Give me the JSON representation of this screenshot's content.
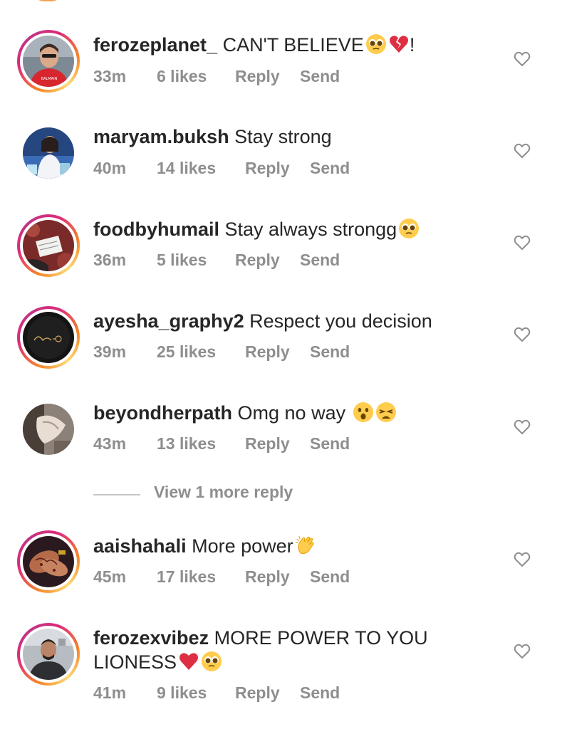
{
  "comments": [
    {
      "username": "ferozeplanet_",
      "text": "CAN'T BELIEVE",
      "text2": "",
      "emojis": [
        "pleading-face",
        "broken-heart"
      ],
      "suffix": "!",
      "time": "33m",
      "likes": "6 likes",
      "reply": "Reply",
      "send": "Send"
    },
    {
      "username": "maryam.buksh",
      "text": "Stay strong",
      "text2": "",
      "emojis": [],
      "suffix": "",
      "time": "40m",
      "likes": "14 likes",
      "reply": "Reply",
      "send": "Send"
    },
    {
      "username": "foodbyhumail",
      "text": "Stay always strongg",
      "text2": "",
      "emojis": [
        "pleading-face"
      ],
      "suffix": "",
      "time": "36m",
      "likes": "5 likes",
      "reply": "Reply",
      "send": "Send"
    },
    {
      "username": "ayesha_graphy2",
      "text": "Respect you decision",
      "text2": "",
      "emojis": [],
      "suffix": "",
      "time": "39m",
      "likes": "25 likes",
      "reply": "Reply",
      "send": "Send"
    },
    {
      "username": "beyondherpath",
      "text": "Omg no way",
      "text2": "",
      "emojis": [
        "astonished-face",
        "weary-face"
      ],
      "suffix": "",
      "time": "43m",
      "likes": "13 likes",
      "reply": "Reply",
      "send": "Send"
    },
    {
      "username": "aaishahali",
      "text": "More power",
      "text2": "",
      "emojis": [
        "clapping-hands"
      ],
      "suffix": "",
      "time": "45m",
      "likes": "17 likes",
      "reply": "Reply",
      "send": "Send"
    },
    {
      "username": "ferozexvibez",
      "text": "MORE POWER TO YOU",
      "text2": "LIONESS",
      "emojis": [
        "red-heart",
        "pleading-face"
      ],
      "suffix": "",
      "time": "41m",
      "likes": "9 likes",
      "reply": "Reply",
      "send": "Send"
    }
  ],
  "view_more_replies": "View 1 more reply",
  "colors": {
    "primary_text": "#262626",
    "secondary_text": "#8e8e8e",
    "story_ring": "#dd2a7b"
  }
}
